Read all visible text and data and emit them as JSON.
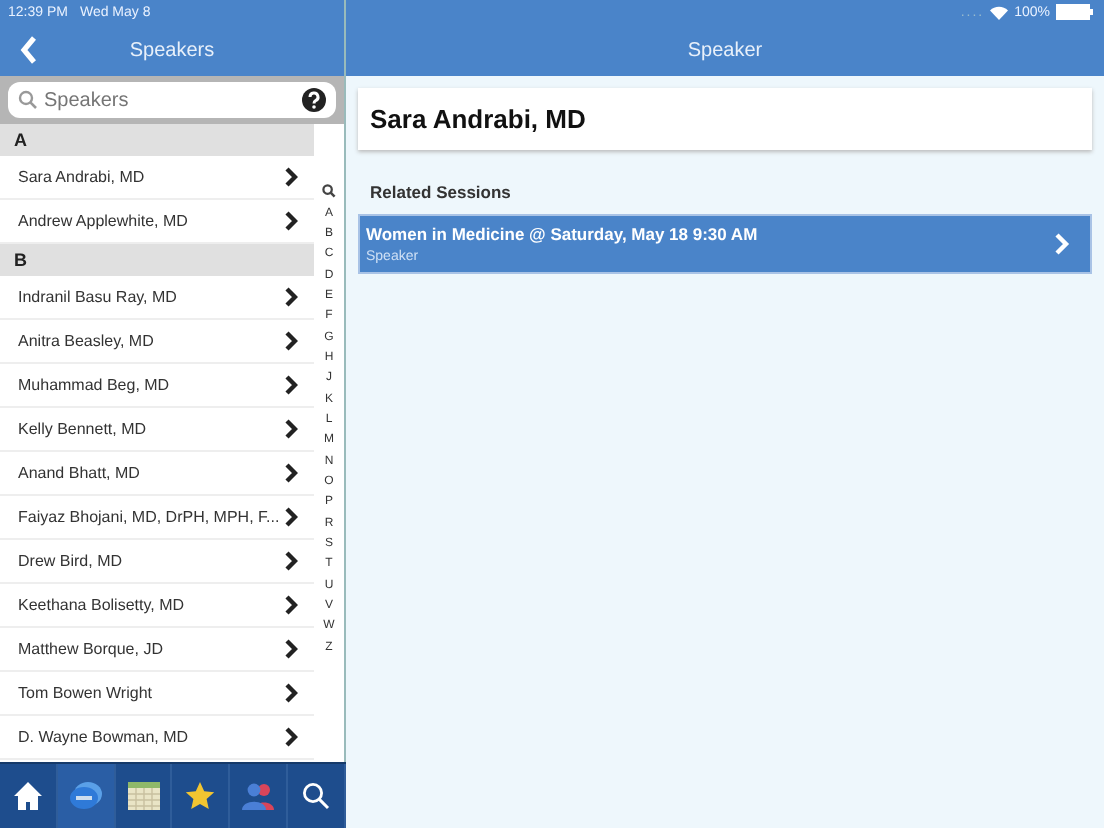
{
  "status_bar": {
    "time": "12:39 PM",
    "date": "Wed May 8",
    "signal": "....",
    "battery": "100%"
  },
  "left_nav": {
    "title": "Speakers"
  },
  "search": {
    "placeholder": "Speakers"
  },
  "sections": [
    {
      "letter": "A",
      "speakers": [
        "Sara Andrabi, MD",
        "Andrew Applewhite, MD"
      ]
    },
    {
      "letter": "B",
      "speakers": [
        "Indranil Basu Ray, MD",
        "Anitra Beasley, MD",
        "Muhammad Beg, MD",
        "Kelly Bennett, MD",
        "Anand Bhatt, MD",
        "Faiyaz Bhojani, MD, DrPH, MPH, F...",
        "Drew Bird, MD",
        "Keethana Bolisetty, MD",
        "Matthew Borque, JD",
        "Tom Bowen Wright",
        "D. Wayne Bowman, MD"
      ]
    }
  ],
  "index": [
    "A",
    "B",
    "C",
    "D",
    "E",
    "F",
    "G",
    "H",
    "J",
    "K",
    "L",
    "M",
    "N",
    "O",
    "P",
    "R",
    "S",
    "T",
    "U",
    "V",
    "W",
    "Z"
  ],
  "right_nav": {
    "title": "Speaker"
  },
  "detail": {
    "name": "Sara Andrabi, MD",
    "sessions_heading": "Related Sessions",
    "sessions": [
      {
        "title": "Women in Medicine @ Saturday, May 18 9:30 AM",
        "role": "Speaker"
      }
    ]
  },
  "tab_bar": [
    {
      "kind": "home",
      "selected": false
    },
    {
      "kind": "chat",
      "selected": true
    },
    {
      "kind": "calendar",
      "selected": false
    },
    {
      "kind": "star",
      "selected": false
    },
    {
      "kind": "people",
      "selected": false
    },
    {
      "kind": "search",
      "selected": false
    }
  ]
}
